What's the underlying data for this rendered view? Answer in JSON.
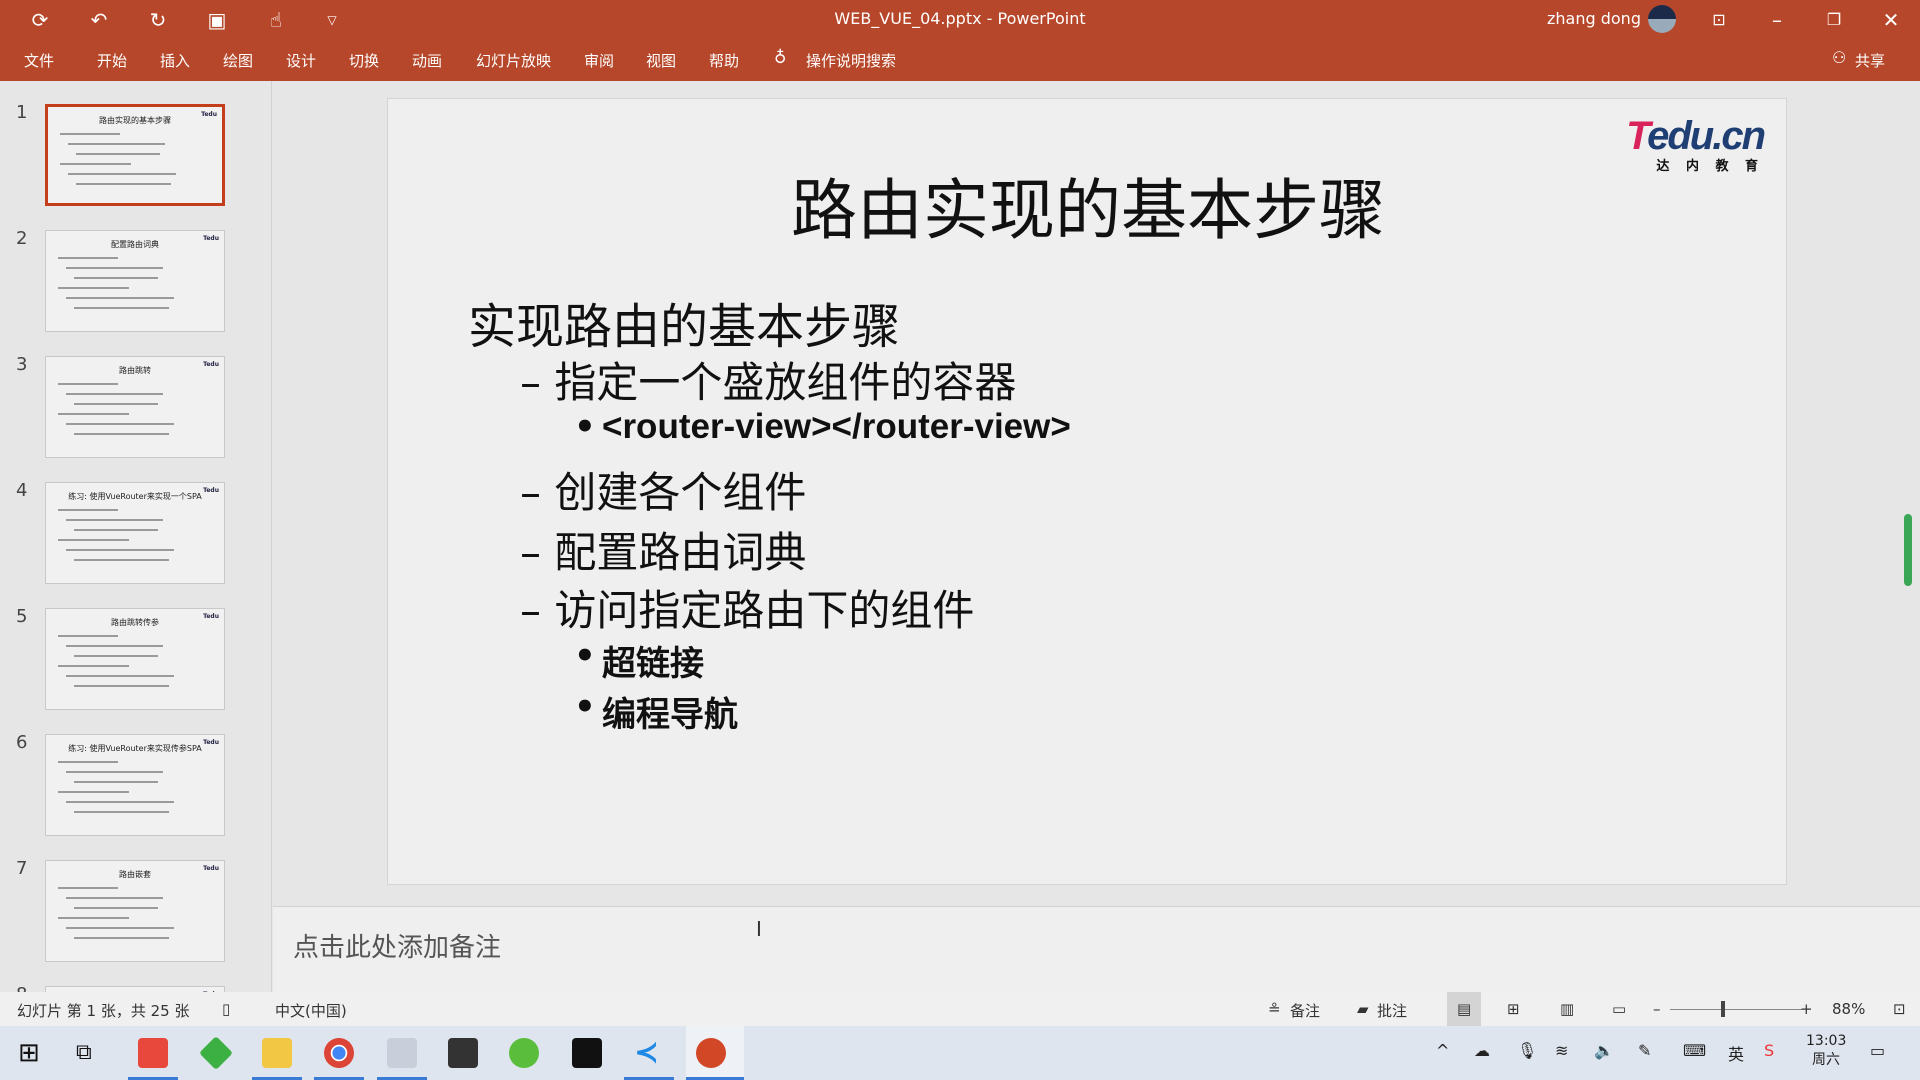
{
  "window": {
    "title": "WEB_VUE_04.pptx  -  PowerPoint",
    "user": "zhang dong",
    "share": "共享"
  },
  "ribbon": {
    "tabs": [
      "文件",
      "开始",
      "插入",
      "绘图",
      "设计",
      "切换",
      "动画",
      "幻灯片放映",
      "审阅",
      "视图",
      "帮助"
    ],
    "search": "操作说明搜索"
  },
  "thumbnails": [
    {
      "num": "1",
      "title": "路由实现的基本步骤"
    },
    {
      "num": "2",
      "title": "配置路由词典"
    },
    {
      "num": "3",
      "title": "路由跳转"
    },
    {
      "num": "4",
      "title": "练习: 使用VueRouter来实现一个SPA"
    },
    {
      "num": "5",
      "title": "路由跳转传参"
    },
    {
      "num": "6",
      "title": "练习: 使用VueRouter来实现传参SPA"
    },
    {
      "num": "7",
      "title": "路由嵌套"
    },
    {
      "num": "8",
      "title": ""
    }
  ],
  "slide": {
    "logo": "Tedu.cn",
    "logo_sub": "达 内 教 育",
    "title": "路由实现的基本步骤",
    "l1": "实现路由的基本步骤",
    "l2a": "– 指定一个盛放组件的容器",
    "l3a": "<router-view></router-view>",
    "l2b": "– 创建各个组件",
    "l2c": "– 配置路由词典",
    "l2d": "– 访问指定路由下的组件",
    "l3b": "超链接",
    "l3c": "编程导航",
    "bullet": "•"
  },
  "notes": {
    "placeholder": "点击此处添加备注"
  },
  "status": {
    "slide_info": "幻灯片 第 1 张，共 25 张",
    "language": "中文(中国)",
    "notes": "备注",
    "comments": "批注",
    "zoom": "88%",
    "zoom_level": 88
  },
  "taskbar": {
    "time": "13:03",
    "day": "周六",
    "ime": "英"
  },
  "colors": {
    "accent": "#b7472a",
    "selected": "#c43e1c",
    "taskbar": "#dfe5ee"
  }
}
